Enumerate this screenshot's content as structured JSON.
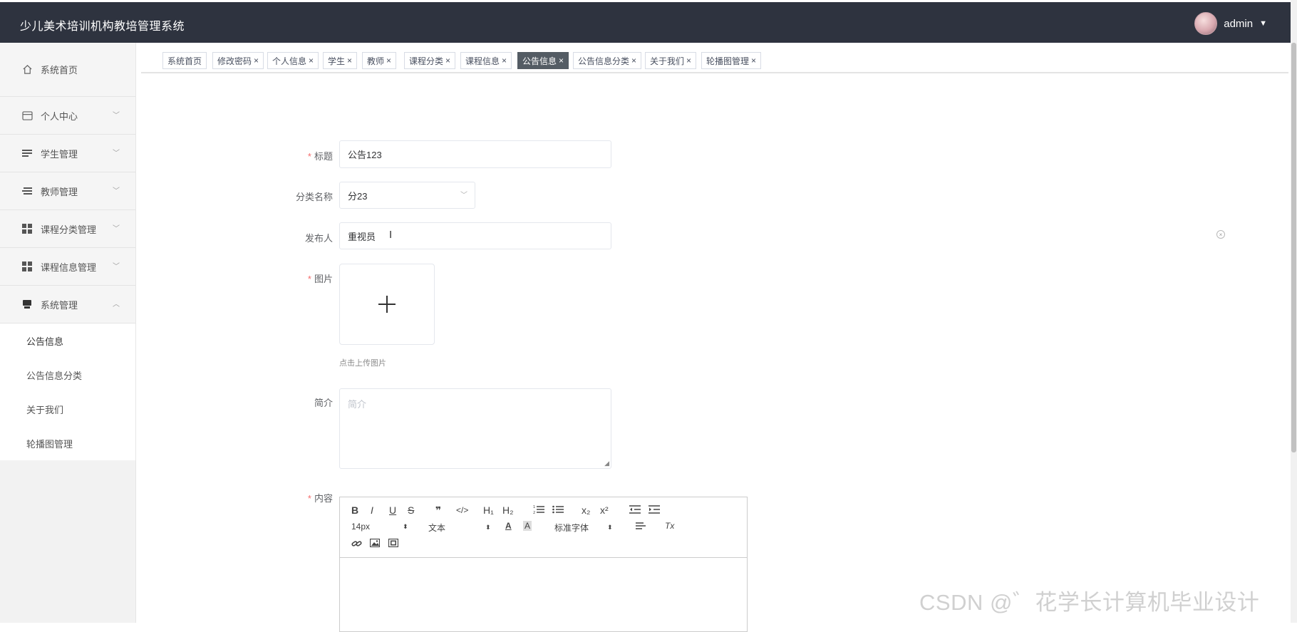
{
  "header": {
    "title": "少儿美术培训机构教培管理系统",
    "user": "admin"
  },
  "sidebar": {
    "items": [
      {
        "label": "系统首页",
        "icon": "home-icon",
        "expandable": false
      },
      {
        "label": "个人中心",
        "icon": "id-card-icon",
        "expandable": true
      },
      {
        "label": "学生管理",
        "icon": "list-icon",
        "expandable": true
      },
      {
        "label": "教师管理",
        "icon": "list-icon",
        "expandable": true
      },
      {
        "label": "课程分类管理",
        "icon": "grid-icon",
        "expandable": true
      },
      {
        "label": "课程信息管理",
        "icon": "grid-icon",
        "expandable": true
      },
      {
        "label": "系统管理",
        "icon": "monitor-icon",
        "expandable": true,
        "expanded": true
      }
    ],
    "submenu": [
      {
        "label": "公告信息",
        "active": true
      },
      {
        "label": "公告信息分类"
      },
      {
        "label": "关于我们"
      },
      {
        "label": "轮播图管理"
      }
    ]
  },
  "tabs": [
    {
      "label": "系统首页",
      "closable": false
    },
    {
      "label": "修改密码",
      "closable": true
    },
    {
      "label": "个人信息",
      "closable": true
    },
    {
      "label": "学生",
      "closable": true
    },
    {
      "label": "教师",
      "closable": true
    },
    {
      "label": "课程分类",
      "closable": true
    },
    {
      "label": "课程信息",
      "closable": true
    },
    {
      "label": "公告信息",
      "closable": true,
      "active": true
    },
    {
      "label": "公告信息分类",
      "closable": true
    },
    {
      "label": "关于我们",
      "closable": true
    },
    {
      "label": "轮播图管理",
      "closable": true
    }
  ],
  "form": {
    "title": {
      "label": "标题",
      "required": true,
      "value": "公告123"
    },
    "category": {
      "label": "分类名称",
      "value": "分23"
    },
    "publisher": {
      "label": "发布人",
      "value": "重视员"
    },
    "image": {
      "label": "图片",
      "required": true,
      "hint": "点击上传图片"
    },
    "intro": {
      "label": "简介",
      "placeholder": "简介"
    },
    "content": {
      "label": "内容",
      "required": true
    }
  },
  "editor": {
    "font_size": "14px",
    "header_select": "文本",
    "font_family": "标准字体",
    "buttons": {
      "bold": "B",
      "italic": "I",
      "underline": "U",
      "strike": "S",
      "quote": "❞",
      "code": "</>",
      "h1": "H₁",
      "h2": "H₂",
      "sub": "x₂",
      "sup": "x²",
      "color": "A",
      "background": "A",
      "clean": "Tx"
    }
  },
  "watermark": "CSDN @゛花学长计算机毕业设计"
}
